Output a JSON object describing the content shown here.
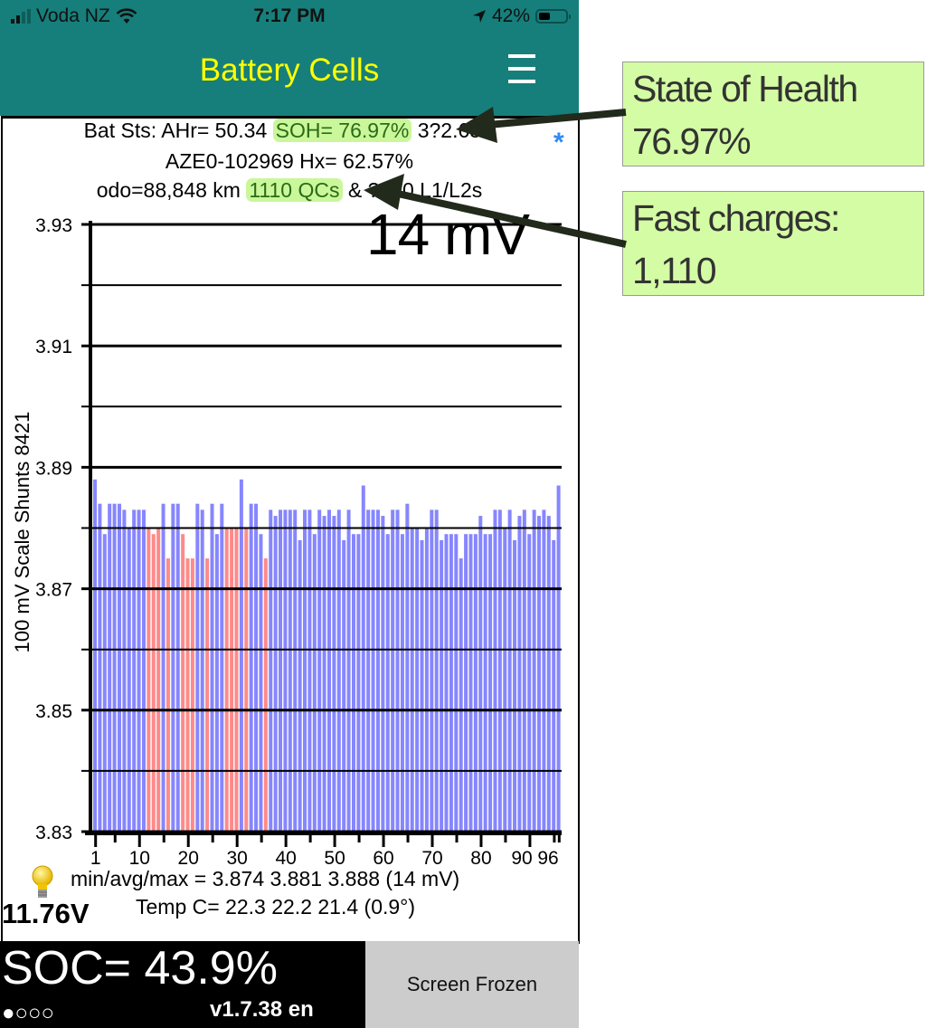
{
  "status_bar": {
    "carrier": "Voda NZ",
    "time": "7:17 PM",
    "battery_percent": "42%",
    "signal_icon": "cellular-signal-icon",
    "wifi_icon": "wifi-icon",
    "location_icon": "location-arrow-icon",
    "battery_icon": "battery-icon"
  },
  "header": {
    "title": "Battery Cells",
    "menu_icon": "hamburger-menu-icon"
  },
  "battery_info": {
    "line1_prefix": "Bat Sts: AHr= 50.34 ",
    "soh": "SOH= 76.97%",
    "line1_suffix": " 3?2.65V",
    "line2": "AZE0-102969   Hx= 62.57%",
    "line3_prefix": "odo=88,848 km ",
    "qcs": "1110 QCs",
    "line3_suffix": " & ?680 L1/L2s",
    "asterisk": "*"
  },
  "chart_data": {
    "type": "bar",
    "title": "",
    "overlay_label": "14 mV",
    "ylabel": "100 mV Scale   Shunts 8421",
    "xlabel": "",
    "ylim": [
      3.83,
      3.93
    ],
    "y_ticks": [
      "3.93",
      "3.91",
      "3.89",
      "3.87",
      "3.85",
      "3.83"
    ],
    "x_ticks": [
      "1",
      "10",
      "20",
      "30",
      "40",
      "50",
      "60",
      "70",
      "80",
      "90",
      "96"
    ],
    "grid": true,
    "reference_line": 3.88,
    "colors": {
      "normal": "#8686ff",
      "shunted": "#ff8a8a"
    },
    "cells": [
      {
        "cell": 1,
        "v": 3.888,
        "shunt": false
      },
      {
        "cell": 2,
        "v": 3.884,
        "shunt": false
      },
      {
        "cell": 3,
        "v": 3.879,
        "shunt": false
      },
      {
        "cell": 4,
        "v": 3.884,
        "shunt": false
      },
      {
        "cell": 5,
        "v": 3.884,
        "shunt": false
      },
      {
        "cell": 6,
        "v": 3.884,
        "shunt": false
      },
      {
        "cell": 7,
        "v": 3.883,
        "shunt": false
      },
      {
        "cell": 8,
        "v": 3.88,
        "shunt": false
      },
      {
        "cell": 9,
        "v": 3.883,
        "shunt": false
      },
      {
        "cell": 10,
        "v": 3.883,
        "shunt": false
      },
      {
        "cell": 11,
        "v": 3.883,
        "shunt": false
      },
      {
        "cell": 12,
        "v": 3.88,
        "shunt": true
      },
      {
        "cell": 13,
        "v": 3.879,
        "shunt": true
      },
      {
        "cell": 14,
        "v": 3.88,
        "shunt": true
      },
      {
        "cell": 15,
        "v": 3.884,
        "shunt": false
      },
      {
        "cell": 16,
        "v": 3.875,
        "shunt": true
      },
      {
        "cell": 17,
        "v": 3.884,
        "shunt": false
      },
      {
        "cell": 18,
        "v": 3.884,
        "shunt": false
      },
      {
        "cell": 19,
        "v": 3.879,
        "shunt": true
      },
      {
        "cell": 20,
        "v": 3.875,
        "shunt": true
      },
      {
        "cell": 21,
        "v": 3.875,
        "shunt": true
      },
      {
        "cell": 22,
        "v": 3.884,
        "shunt": false
      },
      {
        "cell": 23,
        "v": 3.883,
        "shunt": false
      },
      {
        "cell": 24,
        "v": 3.875,
        "shunt": true
      },
      {
        "cell": 25,
        "v": 3.884,
        "shunt": false
      },
      {
        "cell": 26,
        "v": 3.879,
        "shunt": false
      },
      {
        "cell": 27,
        "v": 3.884,
        "shunt": false
      },
      {
        "cell": 28,
        "v": 3.88,
        "shunt": true
      },
      {
        "cell": 29,
        "v": 3.88,
        "shunt": true
      },
      {
        "cell": 30,
        "v": 3.88,
        "shunt": true
      },
      {
        "cell": 31,
        "v": 3.888,
        "shunt": false
      },
      {
        "cell": 32,
        "v": 3.88,
        "shunt": true
      },
      {
        "cell": 33,
        "v": 3.884,
        "shunt": false
      },
      {
        "cell": 34,
        "v": 3.884,
        "shunt": false
      },
      {
        "cell": 35,
        "v": 3.879,
        "shunt": false
      },
      {
        "cell": 36,
        "v": 3.875,
        "shunt": true
      },
      {
        "cell": 37,
        "v": 3.883,
        "shunt": false
      },
      {
        "cell": 38,
        "v": 3.882,
        "shunt": false
      },
      {
        "cell": 39,
        "v": 3.883,
        "shunt": false
      },
      {
        "cell": 40,
        "v": 3.883,
        "shunt": false
      },
      {
        "cell": 41,
        "v": 3.883,
        "shunt": false
      },
      {
        "cell": 42,
        "v": 3.883,
        "shunt": false
      },
      {
        "cell": 43,
        "v": 3.878,
        "shunt": false
      },
      {
        "cell": 44,
        "v": 3.883,
        "shunt": false
      },
      {
        "cell": 45,
        "v": 3.883,
        "shunt": false
      },
      {
        "cell": 46,
        "v": 3.879,
        "shunt": false
      },
      {
        "cell": 47,
        "v": 3.883,
        "shunt": false
      },
      {
        "cell": 48,
        "v": 3.882,
        "shunt": false
      },
      {
        "cell": 49,
        "v": 3.883,
        "shunt": false
      },
      {
        "cell": 50,
        "v": 3.882,
        "shunt": false
      },
      {
        "cell": 51,
        "v": 3.883,
        "shunt": false
      },
      {
        "cell": 52,
        "v": 3.878,
        "shunt": false
      },
      {
        "cell": 53,
        "v": 3.883,
        "shunt": false
      },
      {
        "cell": 54,
        "v": 3.879,
        "shunt": false
      },
      {
        "cell": 55,
        "v": 3.879,
        "shunt": false
      },
      {
        "cell": 56,
        "v": 3.887,
        "shunt": false
      },
      {
        "cell": 57,
        "v": 3.883,
        "shunt": false
      },
      {
        "cell": 58,
        "v": 3.883,
        "shunt": false
      },
      {
        "cell": 59,
        "v": 3.883,
        "shunt": false
      },
      {
        "cell": 60,
        "v": 3.882,
        "shunt": false
      },
      {
        "cell": 61,
        "v": 3.879,
        "shunt": false
      },
      {
        "cell": 62,
        "v": 3.883,
        "shunt": false
      },
      {
        "cell": 63,
        "v": 3.883,
        "shunt": false
      },
      {
        "cell": 64,
        "v": 3.879,
        "shunt": false
      },
      {
        "cell": 65,
        "v": 3.884,
        "shunt": false
      },
      {
        "cell": 66,
        "v": 3.88,
        "shunt": false
      },
      {
        "cell": 67,
        "v": 3.88,
        "shunt": false
      },
      {
        "cell": 68,
        "v": 3.878,
        "shunt": false
      },
      {
        "cell": 69,
        "v": 3.88,
        "shunt": false
      },
      {
        "cell": 70,
        "v": 3.883,
        "shunt": false
      },
      {
        "cell": 71,
        "v": 3.883,
        "shunt": false
      },
      {
        "cell": 72,
        "v": 3.878,
        "shunt": false
      },
      {
        "cell": 73,
        "v": 3.879,
        "shunt": false
      },
      {
        "cell": 74,
        "v": 3.879,
        "shunt": false
      },
      {
        "cell": 75,
        "v": 3.879,
        "shunt": false
      },
      {
        "cell": 76,
        "v": 3.875,
        "shunt": false
      },
      {
        "cell": 77,
        "v": 3.879,
        "shunt": false
      },
      {
        "cell": 78,
        "v": 3.879,
        "shunt": false
      },
      {
        "cell": 79,
        "v": 3.879,
        "shunt": false
      },
      {
        "cell": 80,
        "v": 3.882,
        "shunt": false
      },
      {
        "cell": 81,
        "v": 3.879,
        "shunt": false
      },
      {
        "cell": 82,
        "v": 3.879,
        "shunt": false
      },
      {
        "cell": 83,
        "v": 3.883,
        "shunt": false
      },
      {
        "cell": 84,
        "v": 3.883,
        "shunt": false
      },
      {
        "cell": 85,
        "v": 3.88,
        "shunt": false
      },
      {
        "cell": 86,
        "v": 3.883,
        "shunt": false
      },
      {
        "cell": 87,
        "v": 3.878,
        "shunt": false
      },
      {
        "cell": 88,
        "v": 3.882,
        "shunt": false
      },
      {
        "cell": 89,
        "v": 3.883,
        "shunt": false
      },
      {
        "cell": 90,
        "v": 3.879,
        "shunt": false
      },
      {
        "cell": 91,
        "v": 3.883,
        "shunt": false
      },
      {
        "cell": 92,
        "v": 3.882,
        "shunt": false
      },
      {
        "cell": 93,
        "v": 3.883,
        "shunt": false
      },
      {
        "cell": 94,
        "v": 3.882,
        "shunt": false
      },
      {
        "cell": 95,
        "v": 3.878,
        "shunt": false
      },
      {
        "cell": 96,
        "v": 3.887,
        "shunt": false
      }
    ]
  },
  "stats": {
    "minavgmax": "min/avg/max = 3.874 3.881 3.888  (14 mV)",
    "temp": "Temp C= 22.3  22.2  21.4  (0.9°)",
    "aux_voltage": "11.76V",
    "bulb_icon": "lightbulb-icon"
  },
  "footer": {
    "soc": "SOC= 43.9%",
    "page_dots": "●○○○",
    "version": "v1.7.38 en",
    "screen_frozen_button": "Screen Frozen"
  },
  "annotations": [
    {
      "line1": "State of Health",
      "line2": "76.97%"
    },
    {
      "line1": "Fast charges:",
      "line2": "1,110"
    }
  ]
}
